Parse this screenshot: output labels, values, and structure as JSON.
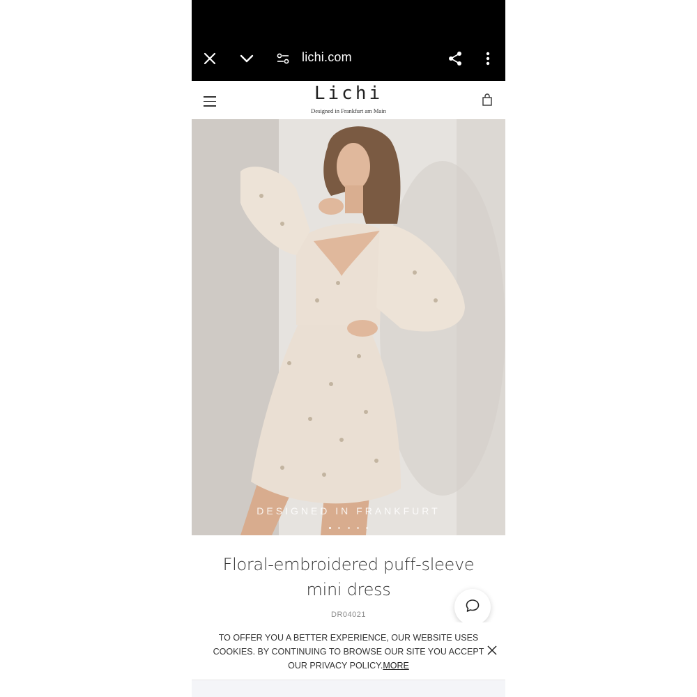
{
  "browser": {
    "url": "lichi.com",
    "icons": [
      "close-icon",
      "chevron-down-icon",
      "site-settings-icon",
      "share-icon",
      "more-vertical-icon"
    ]
  },
  "site": {
    "logo": "Lichi",
    "tagline": "Designed in Frankfurt am Main",
    "icons": [
      "menu-icon",
      "bag-icon"
    ]
  },
  "hero": {
    "caption": "DESIGNED IN FRANKFURT",
    "slides_total": 5,
    "active_slide": 1
  },
  "product": {
    "title": "Floral-embroidered puff-sleeve mini dress",
    "sku": "DR04021"
  },
  "cookie": {
    "text": "TO OFFER YOU A BETTER EXPERIENCE, OUR WEBSITE USES COOKIES. BY CONTINUING TO BROWSE OUR SITE YOU ACCEPT OUR PRIVACY POLICY.",
    "more_label": "MORE"
  },
  "colors": {
    "browser_bar": "#000000",
    "text": "#333333",
    "dress": "#eadfd3"
  }
}
